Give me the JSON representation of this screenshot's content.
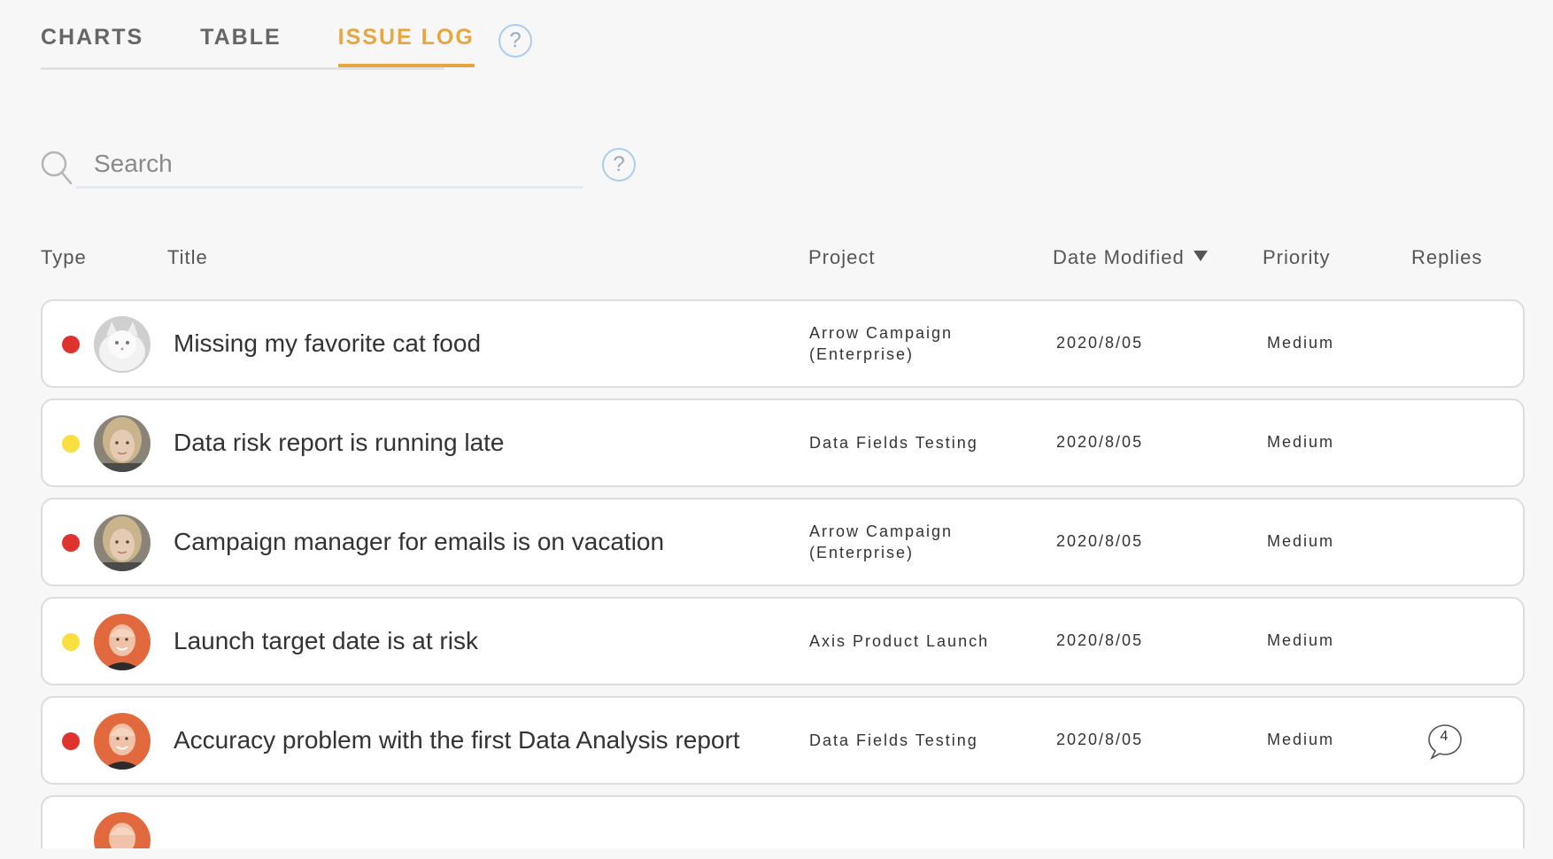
{
  "tabs": [
    {
      "label": "CHARTS",
      "active": false
    },
    {
      "label": "TABLE",
      "active": false
    },
    {
      "label": "ISSUE LOG",
      "active": true
    }
  ],
  "help": {
    "glyph": "?"
  },
  "search": {
    "placeholder": "Search",
    "value": ""
  },
  "table": {
    "columns": {
      "type": "Type",
      "title": "Title",
      "project": "Project",
      "date_modified": "Date Modified",
      "priority": "Priority",
      "replies": "Replies"
    },
    "sort": {
      "column": "date_modified",
      "direction": "descending"
    },
    "rows": [
      {
        "type_color": "#e0322e",
        "avatar": "cat",
        "title": "Missing my favorite cat food",
        "project": "Arrow Campaign (Enterprise)",
        "date": "2020/8/05",
        "priority": "Medium",
        "replies": ""
      },
      {
        "type_color": "#f7e040",
        "avatar": "woman",
        "title": "Data risk report is running late",
        "project": "Data Fields Testing",
        "date": "2020/8/05",
        "priority": "Medium",
        "replies": ""
      },
      {
        "type_color": "#e0322e",
        "avatar": "woman",
        "title": "Campaign manager for emails is on vacation",
        "project": "Arrow Campaign (Enterprise)",
        "date": "2020/8/05",
        "priority": "Medium",
        "replies": ""
      },
      {
        "type_color": "#f7e040",
        "avatar": "man",
        "title": "Launch target date is at risk",
        "project": "Axis Product Launch",
        "date": "2020/8/05",
        "priority": "Medium",
        "replies": ""
      },
      {
        "type_color": "#e0322e",
        "avatar": "man",
        "title": "Accuracy problem with the first Data Analysis report",
        "project": "Data Fields Testing",
        "date": "2020/8/05",
        "priority": "Medium",
        "replies": "4"
      }
    ]
  },
  "colors": {
    "accent": "#e8a640",
    "status_red": "#e0322e",
    "status_yellow": "#f7e040",
    "help_border": "#a9cdf0"
  },
  "icons": {
    "search": "search-icon",
    "help": "help-icon",
    "sort": "sort-desc-icon",
    "reply": "speech-bubble-icon"
  }
}
